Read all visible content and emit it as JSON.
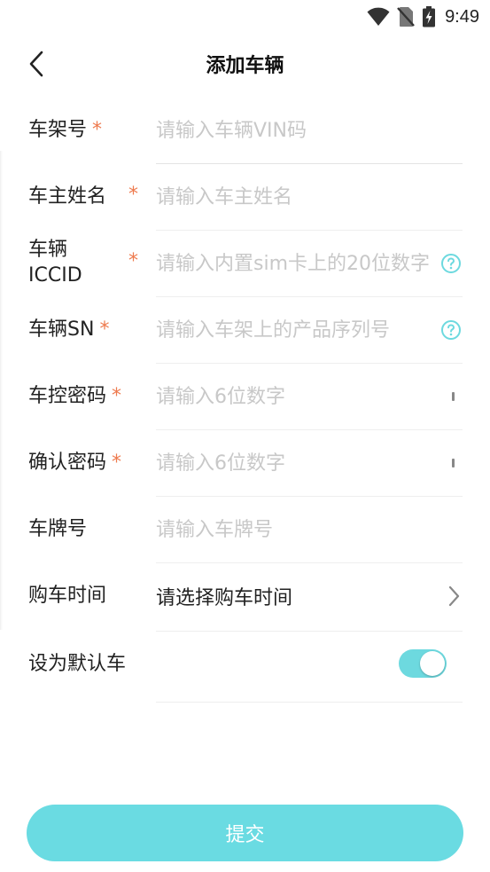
{
  "status_bar": {
    "time": "9:49",
    "icons": [
      "wifi-icon",
      "no-sim-icon",
      "battery-charging-icon"
    ]
  },
  "header": {
    "title": "添加车辆",
    "back_icon": "chevron-left-icon"
  },
  "form": {
    "vin": {
      "label": "车架号",
      "required_mark": "*",
      "placeholder": "请输入车辆VIN码"
    },
    "owner": {
      "label": "车主姓名",
      "required_mark": "*",
      "placeholder": "请输入车主姓名"
    },
    "iccid": {
      "label_line1": "车辆",
      "label_line2": "ICCID",
      "required_mark": "*",
      "placeholder": "请输入内置sim卡上的20位数字",
      "help_icon": "question-circle-icon"
    },
    "sn": {
      "label": "车辆SN",
      "required_mark": "*",
      "placeholder": "请输入车架上的产品序列号",
      "help_icon": "question-circle-icon"
    },
    "control_password": {
      "label": "车控密码",
      "required_mark": "*",
      "placeholder": "请输入6位数字",
      "eye_icon": "eye-closed-icon"
    },
    "confirm_password": {
      "label": "确认密码",
      "required_mark": "*",
      "placeholder": "请输入6位数字",
      "eye_icon": "eye-closed-icon"
    },
    "plate": {
      "label": "车牌号",
      "placeholder": "请输入车牌号"
    },
    "purchase_time": {
      "label": "购车时间",
      "value": "请选择购车时间",
      "chevron_icon": "chevron-right-icon"
    },
    "default_car": {
      "label": "设为默认车",
      "enabled": true
    }
  },
  "submit": {
    "label": "提交"
  },
  "colors": {
    "accent": "#6adbe2",
    "required": "#ee7a4e",
    "placeholder": "#c8c8c8",
    "help_icon": "#6dd9df"
  }
}
